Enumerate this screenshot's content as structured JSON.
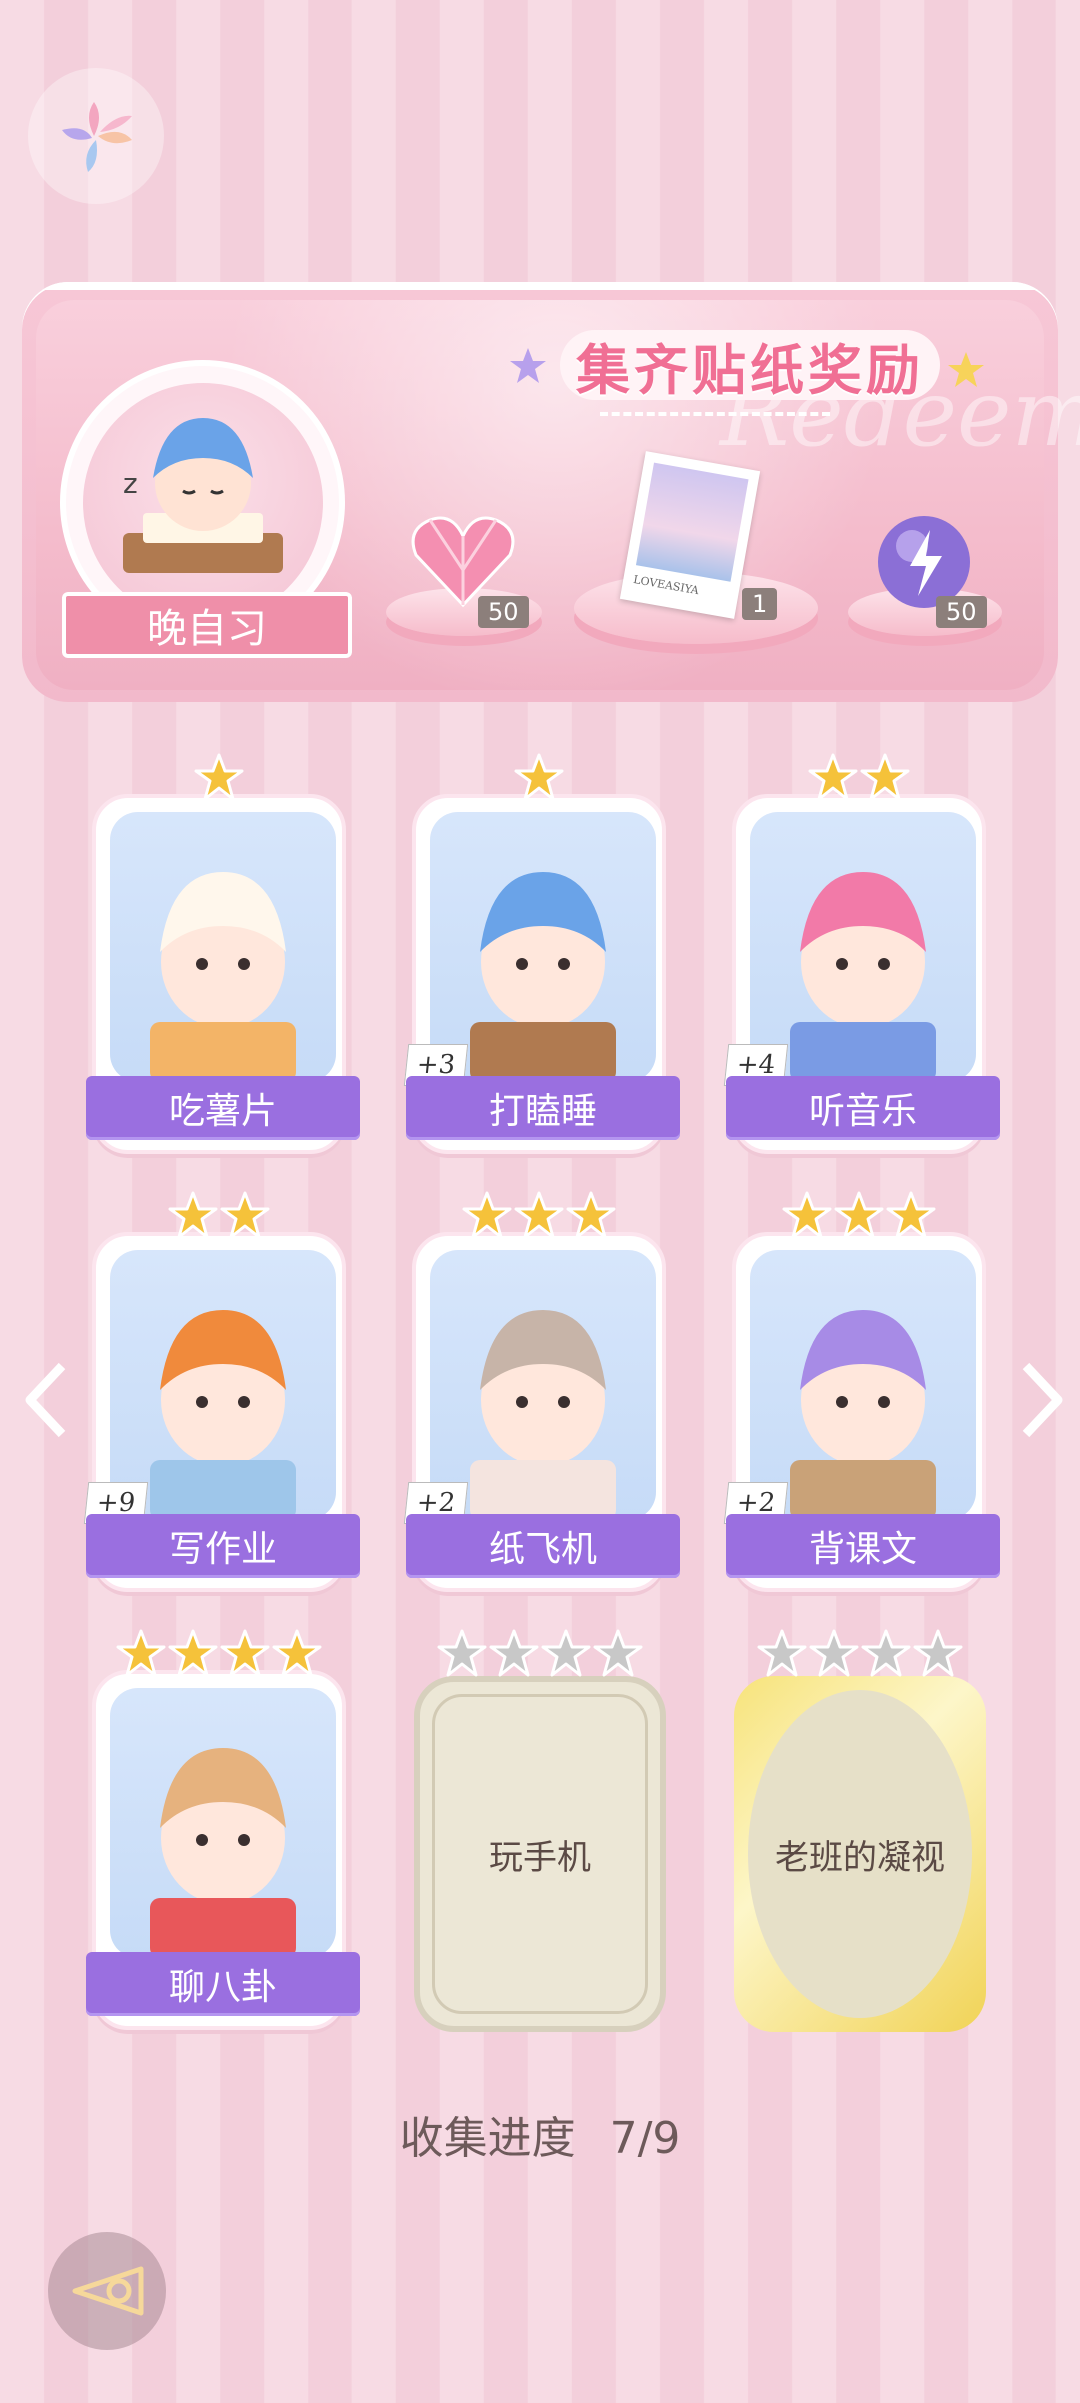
{
  "banner": {
    "title": "集齐贴纸奖励",
    "watermark": "Redeem",
    "event_name": "晚自习",
    "rewards": [
      {
        "icon": "pink-heart-gem-icon",
        "count": "50"
      },
      {
        "icon": "photo-card-icon",
        "count": "1",
        "card_caption": "LOVEASIYA"
      },
      {
        "icon": "lightning-orb-icon",
        "count": "50"
      }
    ]
  },
  "cards": [
    {
      "label": "吃薯片",
      "stars": 1,
      "bonus": "",
      "art": "cat-eating-chips"
    },
    {
      "label": "打瞌睡",
      "stars": 1,
      "bonus": "+3",
      "art": "boy-sleeping-on-desk"
    },
    {
      "label": "听音乐",
      "stars": 2,
      "bonus": "+4",
      "art": "girl-with-headphones"
    },
    {
      "label": "写作业",
      "stars": 2,
      "bonus": "+9",
      "art": "boy-doing-homework"
    },
    {
      "label": "纸飞机",
      "stars": 3,
      "bonus": "+2",
      "art": "cat-on-paper-plane"
    },
    {
      "label": "背课文",
      "stars": 3,
      "bonus": "+2",
      "art": "girl-in-classroom"
    },
    {
      "label": "聊八卦",
      "stars": 4,
      "bonus": "",
      "art": "dog-eating-watermelon"
    }
  ],
  "locked_cards": [
    {
      "label": "玩手机",
      "stars": 4,
      "style": "cream"
    },
    {
      "label": "老班的凝视",
      "stars": 4,
      "style": "gold"
    }
  ],
  "progress": {
    "label": "收集进度",
    "value": "7/9"
  },
  "colors": {
    "accent": "#9a6fe0",
    "title": "#f06f94",
    "star": "#f5c23a",
    "star_locked": "#c8c8c8"
  }
}
